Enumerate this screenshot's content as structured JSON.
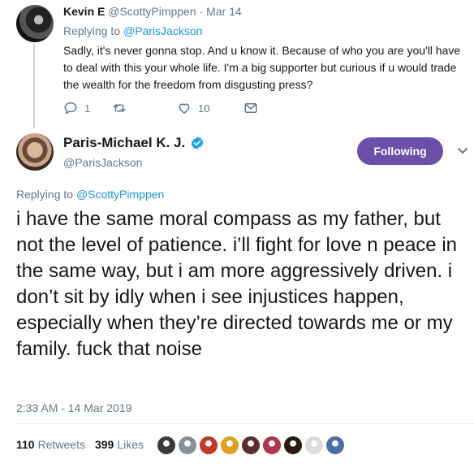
{
  "parent_tweet": {
    "name": "Kevin E",
    "handle": "@ScottyPimppen",
    "dot": " · ",
    "date": "Mar 14",
    "replying_prefix": "Replying to ",
    "replying_to": "@ParisJackson",
    "text": "Sadly, it's never gonna stop. And u know it. Because of who you are you'll have to deal with this your whole life. I'm a big supporter but curious if u would trade the wealth for the freedom from disgusting press?",
    "reply_count": "1",
    "retweet_count": "",
    "like_count": "10"
  },
  "main_tweet": {
    "name": "Paris-Michael K. J.",
    "handle": "@ParisJackson",
    "follow_label": "Following",
    "replying_prefix": "Replying to ",
    "replying_to": "@ScottyPimppen",
    "text": "i have the same moral compass as my father, but not the level of patience. i’ll fight for love n peace in the same way, but i am more aggressively driven. i don’t sit by idly when i see injustices happen, especially when they’re directed towards me or my family. fuck that noise",
    "timestamp": "2:33 AM - 14 Mar 2019",
    "retweets_count": "110",
    "retweets_label": "Retweets",
    "likes_count": "399",
    "likes_label": "Likes"
  },
  "colors": {
    "accent": "#1b95e0",
    "follow_button": "#6c4fa8",
    "muted": "#657786",
    "text": "#14171a"
  },
  "icons": [
    "reply-icon",
    "retweet-icon",
    "heart-icon",
    "message-icon",
    "verified-badge-icon",
    "chevron-down-icon"
  ],
  "likers": [
    {
      "color": "#3a3a3a"
    },
    {
      "color": "#8a8f96"
    },
    {
      "color": "#c0392b"
    },
    {
      "color": "#e0a020"
    },
    {
      "color": "#5a2e2e"
    },
    {
      "color": "#b0344a"
    },
    {
      "color": "#2b1a12"
    },
    {
      "color": "#dcdcdc"
    },
    {
      "color": "#4a6fa5"
    }
  ]
}
